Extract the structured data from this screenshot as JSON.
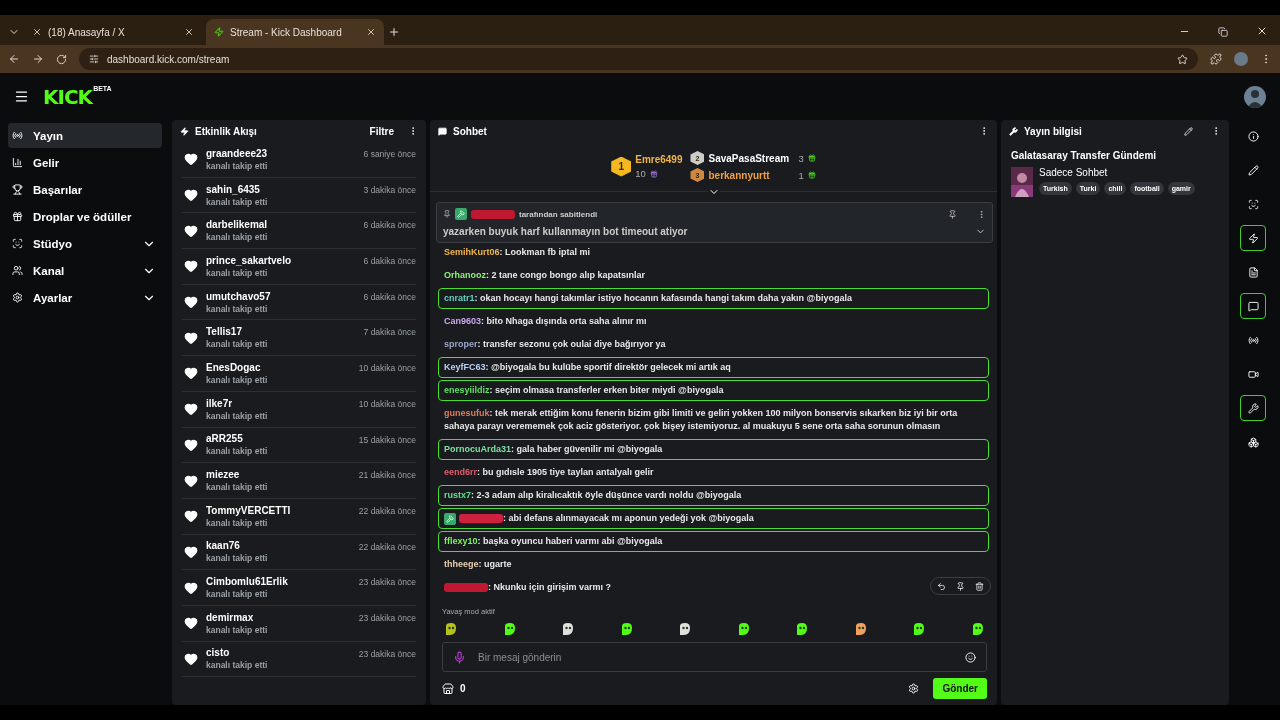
{
  "browser": {
    "tabs": [
      {
        "title": "(18) Anasayfa / X",
        "selected": false
      },
      {
        "title": "Stream - Kick Dashboard",
        "selected": true
      }
    ],
    "url": "dashboard.kick.com/stream"
  },
  "header": {
    "logo": "KICK",
    "logo_badge": "BETA"
  },
  "nav": [
    {
      "label": "Yayın",
      "selected": true,
      "kind": "link"
    },
    {
      "label": "Gelir",
      "selected": false,
      "kind": "link"
    },
    {
      "label": "Başarılar",
      "selected": false,
      "kind": "link"
    },
    {
      "label": "Droplar ve ödüller",
      "selected": false,
      "kind": "link"
    },
    {
      "label": "Stüdyo",
      "selected": false,
      "kind": "group"
    },
    {
      "label": "Kanal",
      "selected": false,
      "kind": "group"
    },
    {
      "label": "Ayarlar",
      "selected": false,
      "kind": "group"
    }
  ],
  "activity": {
    "title": "Etkinlik Akışı",
    "filter": "Filtre",
    "items": [
      {
        "user": "graandeee23",
        "action": "kanalı takip etti",
        "time": "6 saniye önce"
      },
      {
        "user": "sahin_6435",
        "action": "kanalı takip etti",
        "time": "3 dakika önce"
      },
      {
        "user": "darbelikemal",
        "action": "kanalı takip etti",
        "time": "6 dakika önce"
      },
      {
        "user": "prince_sakartvelo",
        "action": "kanalı takip etti",
        "time": "6 dakika önce"
      },
      {
        "user": "umutchavo57",
        "action": "kanalı takip etti",
        "time": "6 dakika önce"
      },
      {
        "user": "Tellis17",
        "action": "kanalı takip etti",
        "time": "7 dakika önce"
      },
      {
        "user": "EnesDogac",
        "action": "kanalı takip etti",
        "time": "10 dakika önce"
      },
      {
        "user": "ilke7r",
        "action": "kanalı takip etti",
        "time": "10 dakika önce"
      },
      {
        "user": "aRR255",
        "action": "kanalı takip etti",
        "time": "15 dakika önce"
      },
      {
        "user": "miezee",
        "action": "kanalı takip etti",
        "time": "21 dakika önce"
      },
      {
        "user": "TommyVERCETTI",
        "action": "kanalı takip etti",
        "time": "22 dakika önce"
      },
      {
        "user": "kaan76",
        "action": "kanalı takip etti",
        "time": "22 dakika önce"
      },
      {
        "user": "Cimbomlu61Erlik",
        "action": "kanalı takip etti",
        "time": "23 dakika önce"
      },
      {
        "user": "demirmax",
        "action": "kanalı takip etti",
        "time": "23 dakika önce"
      },
      {
        "user": "cisto",
        "action": "kanalı takip etti",
        "time": "23 dakika önce"
      }
    ]
  },
  "chat": {
    "title": "Sohbet",
    "leaderboard": [
      {
        "rank": "1",
        "user": "Emre6499",
        "count": "10",
        "color": "#f0b54a"
      },
      {
        "rank": "2",
        "user": "SavaPasaStream",
        "count": "3",
        "color": "#ffffff"
      },
      {
        "rank": "3",
        "user": "berkannyurtt",
        "count": "1",
        "color": "#f0a040"
      }
    ],
    "pinned": {
      "by_label": "tarafından sabitlendi",
      "text": "yazarken buyuk harf kullanmayın bot timeout atiyor"
    },
    "messages": [
      {
        "user": "SemihKurt06",
        "color": "#f0b54a",
        "text": ": Lookman fb iptal mi",
        "highlighted": false,
        "redacted": false,
        "mod": false
      },
      {
        "user": "Orhanooz",
        "color": "#8ff07a",
        "text": ": 2 tane congo bongo alıp kapatsınlar",
        "highlighted": false,
        "redacted": false,
        "mod": false
      },
      {
        "user": "cnratr1",
        "color": "#5ed1c1",
        "text": ": okan hocayı hangi takımlar istiyo hocanın kafasında hangi takım daha yakın @biyogala",
        "highlighted": true,
        "redacted": false,
        "mod": false
      },
      {
        "user": "Can9603",
        "color": "#c9a8f0",
        "text": ": bito Nhaga dışında orta saha alınır mı",
        "highlighted": false,
        "redacted": false,
        "mod": false
      },
      {
        "user": "sproper",
        "color": "#9ca3c8",
        "text": ": transfer sezonu çok oulai diye bağırıyor ya",
        "highlighted": false,
        "redacted": false,
        "mod": false
      },
      {
        "user": "KeyfFC63",
        "color": "#b8d0f0",
        "text": ": @biyogala bu kulübe sportif direktör gelecek mi artık aq",
        "highlighted": true,
        "redacted": false,
        "mod": false
      },
      {
        "user": "enesyiildiz",
        "color": "#5ee05e",
        "text": ": seçim olmasa transferler erken biter miydi @biyogala",
        "highlighted": true,
        "redacted": false,
        "mod": false
      },
      {
        "user": "gunesufuk",
        "color": "#e07a5a",
        "text": ": tek merak ettiğim konu fenerin bizim gibi limiti ve geliri yokken 100 milyon bonservis sıkarken biz iyi bir orta sahaya parayı verememek çok aciz gösteriyor. çok bişey istemiyoruz. al muakuyu 5 sene orta saha sorunun olmasın",
        "highlighted": false,
        "redacted": false,
        "mod": false
      },
      {
        "user": "PornocuArda31",
        "color": "#7fe0a0",
        "text": ": gala haber güvenilir mi @biyogala",
        "highlighted": true,
        "redacted": false,
        "mod": false
      },
      {
        "user": "eend6rr",
        "color": "#e05a6a",
        "text": ": bu gıdısle 1905 tiye taylan antalyalı gelir",
        "highlighted": false,
        "redacted": false,
        "mod": false
      },
      {
        "user": "rustx7",
        "color": "#5fe08f",
        "text": ": 2-3 adam alıp kiralıcaktık öyle düşünce vardı noldu @biyogala",
        "highlighted": true,
        "redacted": false,
        "mod": false
      },
      {
        "color": "#d02040",
        "text": ": abi defans alınmayacak mı aponun yedeği yok @biyogala",
        "highlighted": true,
        "redacted": true,
        "mod": true
      },
      {
        "user": "fflexy10",
        "color": "#7ff05f",
        "text": ": başka oyuncu haberi varmı abi @biyogala",
        "highlighted": true,
        "redacted": false,
        "mod": false
      },
      {
        "user": "thheege",
        "color": "#e8d0b0",
        "text": ": ugarte",
        "highlighted": false,
        "redacted": false,
        "mod": false
      },
      {
        "color": "#c01830",
        "text": ": Nkunku için girişim varmı ?",
        "highlighted": false,
        "redacted": true,
        "mod": false
      }
    ],
    "slow_mode": "Yavaş mod aktif",
    "placeholder": "Bir mesaj gönderin",
    "points": "0",
    "send": "Gönder"
  },
  "info": {
    "title": "Yayın bilgisi",
    "stream_title": "Galatasaray Transfer Gündemi",
    "category": "Sadece Sohbet",
    "tags": [
      "Turkish",
      "Turki",
      "chill",
      "football",
      "gamir"
    ]
  },
  "rail": [
    {
      "selected": false
    },
    {
      "selected": false
    },
    {
      "selected": false
    },
    {
      "selected": true
    },
    {
      "selected": false
    },
    {
      "selected": true
    },
    {
      "selected": false
    },
    {
      "selected": false
    },
    {
      "selected": true
    },
    {
      "selected": false
    }
  ]
}
